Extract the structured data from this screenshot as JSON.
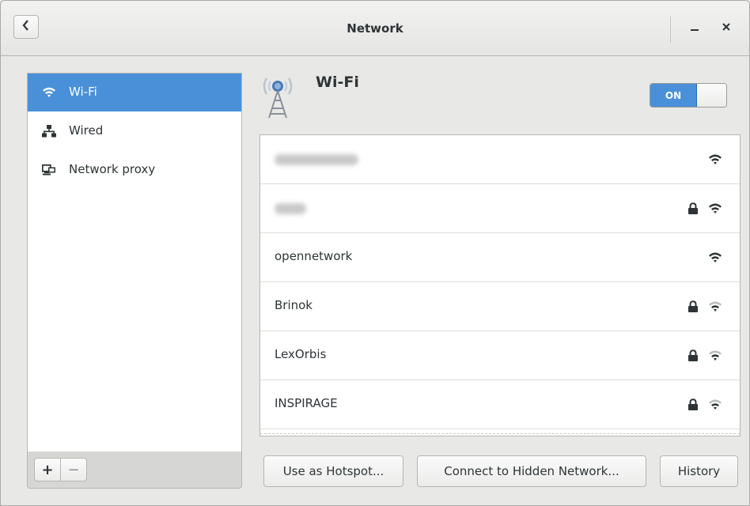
{
  "window": {
    "title": "Network"
  },
  "header": {
    "minimize_label": "–",
    "close_label": "×"
  },
  "sidebar": {
    "items": [
      {
        "label": "Wi-Fi",
        "icon": "wifi-icon",
        "selected": true
      },
      {
        "label": "Wired",
        "icon": "wired-network-icon",
        "selected": false
      },
      {
        "label": "Network proxy",
        "icon": "network-proxy-icon",
        "selected": false
      }
    ],
    "add_label": "+",
    "remove_label": "−"
  },
  "main": {
    "title": "Wi-Fi",
    "switch_label": "ON",
    "networks": [
      {
        "name": "",
        "obscured": true,
        "secured": false,
        "signal": "strong"
      },
      {
        "name": "",
        "obscured": true,
        "secured": true,
        "signal": "strong"
      },
      {
        "name": "opennetwork",
        "obscured": false,
        "secured": false,
        "signal": "strong"
      },
      {
        "name": "Brinok",
        "obscured": false,
        "secured": true,
        "signal": "medium"
      },
      {
        "name": "LexOrbis",
        "obscured": false,
        "secured": true,
        "signal": "medium"
      },
      {
        "name": "INSPIRAGE",
        "obscured": false,
        "secured": true,
        "signal": "medium"
      }
    ],
    "buttons": {
      "hotspot": "Use as Hotspot...",
      "hidden": "Connect to Hidden Network...",
      "history": "History"
    }
  },
  "colors": {
    "accent": "#4a90d9",
    "background": "#e8e8e7"
  }
}
